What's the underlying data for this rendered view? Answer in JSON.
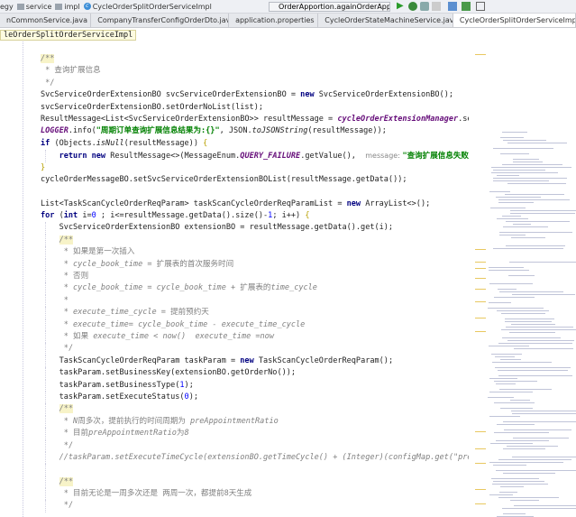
{
  "breadcrumb": [
    "egy",
    "service",
    "impl",
    "CycleOrderSplitOrderServiceImpl"
  ],
  "run_config": "OrderApportion.againOrderApportionTes2",
  "tabs": [
    {
      "label": "nCommonService.java",
      "icon": "#5a8fd0"
    },
    {
      "label": "CompanyTransferConfigOrderDto.java",
      "icon": "#3d8fd8"
    },
    {
      "label": "application.properties",
      "icon": "#6aa84f"
    },
    {
      "label": "CycleOrderStateMachineService.java",
      "icon": "#7fa832"
    },
    {
      "label": "CycleOrderSplitOrderServiceImpl.ja",
      "icon": "#3d8fd8",
      "active": true
    }
  ],
  "class_tag": "leOrderSplitOrderServiceImpl",
  "code": [
    {
      "i": 0,
      "t": [
        [
          "cm doc",
          "/**"
        ]
      ]
    },
    {
      "i": 0,
      "t": [
        [
          "cmn",
          " * 查询扩展信息"
        ]
      ]
    },
    {
      "i": 0,
      "t": [
        [
          "cmn",
          " */"
        ]
      ]
    },
    {
      "i": 0,
      "t": [
        [
          "pl",
          "SvcServiceOrderExtensionBO svcServiceOrderExtensionBO = "
        ],
        [
          "kw",
          "new"
        ],
        [
          "pl",
          " SvcServiceOrderExtensionBO();"
        ]
      ]
    },
    {
      "i": 0,
      "t": [
        [
          "pl",
          "svcServiceOrderExtensionBO.setOrderNoList(list);"
        ]
      ]
    },
    {
      "i": 0,
      "t": [
        [
          "pl",
          "ResultMessage<List<SvcServiceOrderExtensionBO>> resultMessage = "
        ],
        [
          "fld",
          "cycleOrderExtensionManager"
        ],
        [
          "pl",
          ".se"
        ]
      ]
    },
    {
      "i": 0,
      "t": [
        [
          "fld",
          "LOGGER"
        ],
        [
          "pl",
          ".info("
        ],
        [
          "st",
          "\"周期订单查询扩展信息结果为:{}\""
        ],
        [
          "pl",
          ", JSON."
        ],
        [
          "fn",
          "toJSONString"
        ],
        [
          "pl",
          "(resultMessage));"
        ]
      ]
    },
    {
      "i": 0,
      "t": [
        [
          "kw",
          "if"
        ],
        [
          "pl",
          " (Objects."
        ],
        [
          "fn",
          "isNull"
        ],
        [
          "pl",
          "(resultMessage)) "
        ],
        [
          "br",
          "{"
        ]
      ]
    },
    {
      "i": 1,
      "t": [
        [
          "kw",
          "return new"
        ],
        [
          "pl",
          " ResultMessage<>(MessageEnum."
        ],
        [
          "fld",
          "QUERY_FAILURE"
        ],
        [
          "pl",
          ".getValue(),  "
        ],
        [
          "hint",
          "message: "
        ],
        [
          "st",
          "\"查询扩展信息失败\""
        ]
      ]
    },
    {
      "i": 0,
      "t": [
        [
          "br",
          "}"
        ]
      ]
    },
    {
      "i": 0,
      "t": [
        [
          "pl",
          "cycleOrderMessageBO.setSvcServiceOrderExtensionBOList(resultMessage.getData());"
        ]
      ]
    },
    {
      "i": 0,
      "t": []
    },
    {
      "i": 0,
      "t": [
        [
          "pl",
          "List<TaskScanCycleOrderReqParam> taskScanCycleOrderReqParamList = "
        ],
        [
          "kw",
          "new"
        ],
        [
          "pl",
          " ArrayList<>();"
        ]
      ]
    },
    {
      "i": 0,
      "t": [
        [
          "kw",
          "for"
        ],
        [
          "pl",
          " ("
        ],
        [
          "kw",
          "int"
        ],
        [
          "pl",
          " i="
        ],
        [
          "nu",
          "0"
        ],
        [
          "pl",
          " ; i<=resultMessage.getData().size()-"
        ],
        [
          "nu",
          "1"
        ],
        [
          "pl",
          "; i++) "
        ],
        [
          "br",
          "{"
        ]
      ]
    },
    {
      "i": 1,
      "t": [
        [
          "pl",
          "SvcServiceOrderExtensionBO extensionBO = resultMessage.getData().get(i);"
        ]
      ]
    },
    {
      "i": 1,
      "t": [
        [
          "cm doc",
          "/**"
        ]
      ]
    },
    {
      "i": 1,
      "t": [
        [
          "cmn",
          " * 如果是第一次插入"
        ]
      ]
    },
    {
      "i": 1,
      "t": [
        [
          "cmn",
          " * "
        ],
        [
          "cm",
          "cycle_book_time"
        ],
        [
          "cmn",
          " = 扩展表的首次服务时间"
        ]
      ]
    },
    {
      "i": 1,
      "t": [
        [
          "cmn",
          " * 否则"
        ]
      ]
    },
    {
      "i": 1,
      "t": [
        [
          "cmn",
          " * "
        ],
        [
          "cm",
          "cycle_book_time = cycle_book_time + "
        ],
        [
          "cmn",
          "扩展表的"
        ],
        [
          "cm",
          "time_cycle"
        ]
      ]
    },
    {
      "i": 1,
      "t": [
        [
          "cmn",
          " *"
        ]
      ]
    },
    {
      "i": 1,
      "t": [
        [
          "cmn",
          " * "
        ],
        [
          "cm",
          "execute_time_cycle = "
        ],
        [
          "cmn",
          "提前预约天"
        ]
      ]
    },
    {
      "i": 1,
      "t": [
        [
          "cmn",
          " * "
        ],
        [
          "cm",
          "execute_time= cycle_book_time - execute_time_cycle"
        ]
      ]
    },
    {
      "i": 1,
      "t": [
        [
          "cmn",
          " * 如果 "
        ],
        [
          "cm",
          "execute_time < now()  execute_time =now"
        ]
      ]
    },
    {
      "i": 1,
      "t": [
        [
          "cmn",
          " */"
        ]
      ]
    },
    {
      "i": 1,
      "t": [
        [
          "pl",
          "TaskScanCycleOrderReqParam taskParam = "
        ],
        [
          "kw",
          "new"
        ],
        [
          "pl",
          " TaskScanCycleOrderReqParam();"
        ]
      ]
    },
    {
      "i": 1,
      "t": [
        [
          "pl",
          "taskParam.setBusinessKey(extensionBO.getOrderNo());"
        ]
      ]
    },
    {
      "i": 1,
      "t": [
        [
          "pl",
          "taskParam.setBusinessType("
        ],
        [
          "nu",
          "1"
        ],
        [
          "pl",
          ");"
        ]
      ]
    },
    {
      "i": 1,
      "t": [
        [
          "pl",
          "taskParam.setExecuteStatus("
        ],
        [
          "nu",
          "0"
        ],
        [
          "pl",
          ");"
        ]
      ]
    },
    {
      "i": 1,
      "t": [
        [
          "cm doc",
          "/**"
        ]
      ]
    },
    {
      "i": 1,
      "t": [
        [
          "cmn",
          " * "
        ],
        [
          "cm",
          "N"
        ],
        [
          "cmn",
          "周多次，提前执行的时间周期为 "
        ],
        [
          "cm",
          "preAppointmentRatio"
        ]
      ]
    },
    {
      "i": 1,
      "t": [
        [
          "cmn",
          " * 目前"
        ],
        [
          "cm",
          "preAppointmentRatio"
        ],
        [
          "cmn",
          "为"
        ],
        [
          "cm",
          "8"
        ]
      ]
    },
    {
      "i": 1,
      "t": [
        [
          "cmn",
          " */"
        ]
      ]
    },
    {
      "i": 1,
      "t": [
        [
          "cm",
          "//taskParam.setExecuteTimeCycle(extensionBO.getTimeCycle() + (Integer)(configMap.get(\"pre"
        ]
      ]
    },
    {
      "i": 1,
      "t": []
    },
    {
      "i": 1,
      "t": [
        [
          "cm doc",
          "/**"
        ]
      ]
    },
    {
      "i": 1,
      "t": [
        [
          "cmn",
          " * 目前无论是一周多次还是 两周一次，都提前8天生成"
        ]
      ]
    },
    {
      "i": 1,
      "t": [
        [
          "cmn",
          " */"
        ]
      ]
    }
  ]
}
